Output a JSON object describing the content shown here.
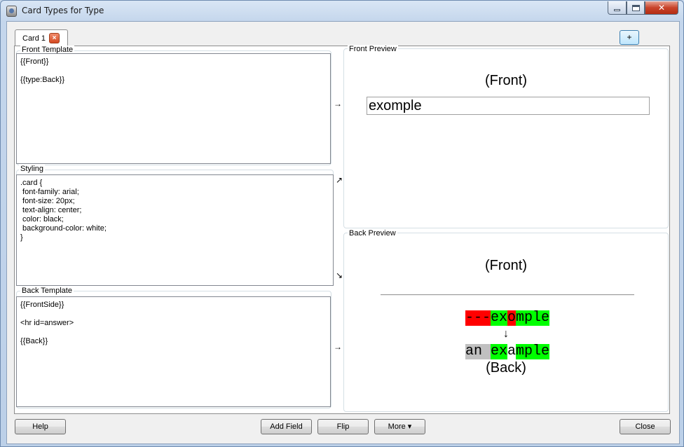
{
  "window": {
    "title": "Card Types for Type"
  },
  "tabs": [
    {
      "label": "Card 1"
    }
  ],
  "add_tab_label": "+",
  "front_template": {
    "label": "Front Template",
    "content": "{{Front}}\n\n{{type:Back}}"
  },
  "styling": {
    "label": "Styling",
    "content": ".card {\n font-family: arial;\n font-size: 20px;\n text-align: center;\n color: black;\n background-color: white;\n}"
  },
  "back_template": {
    "label": "Back Template",
    "content": "{{FrontSide}}\n\n<hr id=answer>\n\n{{Back}}"
  },
  "arrows": {
    "front": "→",
    "styling_up": "↗",
    "styling_down": "↘",
    "back": "→"
  },
  "front_preview": {
    "label": "Front Preview",
    "heading": "(Front)",
    "typed_value": "exomple"
  },
  "back_preview": {
    "label": "Back Preview",
    "heading": "(Front)",
    "typed_segments": [
      {
        "text": "---",
        "status": "bad"
      },
      {
        "text": "ex",
        "status": "good"
      },
      {
        "text": "o",
        "status": "bad"
      },
      {
        "text": "mple",
        "status": "good"
      }
    ],
    "down_arrow": "↓",
    "expected_segments": [
      {
        "text": "an ",
        "status": "missed"
      },
      {
        "text": "ex",
        "status": "good"
      },
      {
        "text": "a",
        "status": "none"
      },
      {
        "text": "mple",
        "status": "good"
      }
    ],
    "back_label": "(Back)"
  },
  "buttons": {
    "help": "Help",
    "add_field": "Add Field",
    "flip": "Flip",
    "more": "More ▾",
    "close": "Close"
  },
  "colors": {
    "bad": "#ff0000",
    "good": "#00ff00",
    "missed": "#c0c0c0"
  }
}
